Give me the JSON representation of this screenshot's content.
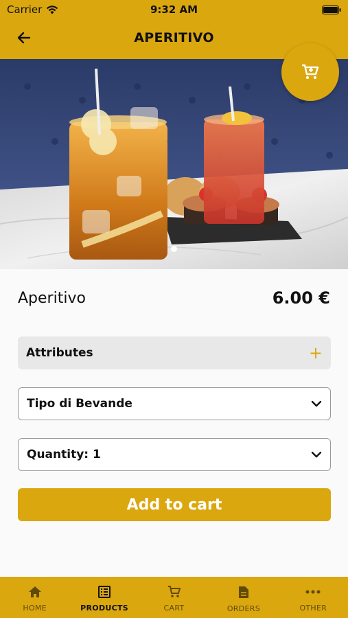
{
  "status_bar": {
    "carrier": "Carrier",
    "time": "9:32 AM"
  },
  "header": {
    "title": "APERITIVO",
    "back_icon": "arrow-left-icon"
  },
  "fab": {
    "icon": "cart-icon"
  },
  "product": {
    "name": "Aperitivo",
    "price": "6.00 €"
  },
  "attributes": {
    "label": "Attributes",
    "icon": "plus-icon"
  },
  "selects": {
    "drink_type": {
      "value": "Tipo di Bevande"
    },
    "quantity": {
      "value": "Quantity: 1"
    }
  },
  "add_to_cart": {
    "label": "Add to cart"
  },
  "tabs": [
    {
      "label": "HOME",
      "icon": "home-icon",
      "active": false
    },
    {
      "label": "PRODUCTS",
      "icon": "list-icon",
      "active": true
    },
    {
      "label": "CART",
      "icon": "cart-icon",
      "active": false
    },
    {
      "label": "ORDERS",
      "icon": "document-icon",
      "active": false
    },
    {
      "label": "OTHER",
      "icon": "more-icon",
      "active": false
    }
  ],
  "colors": {
    "accent": "#dba70f",
    "background": "#fafafa"
  }
}
